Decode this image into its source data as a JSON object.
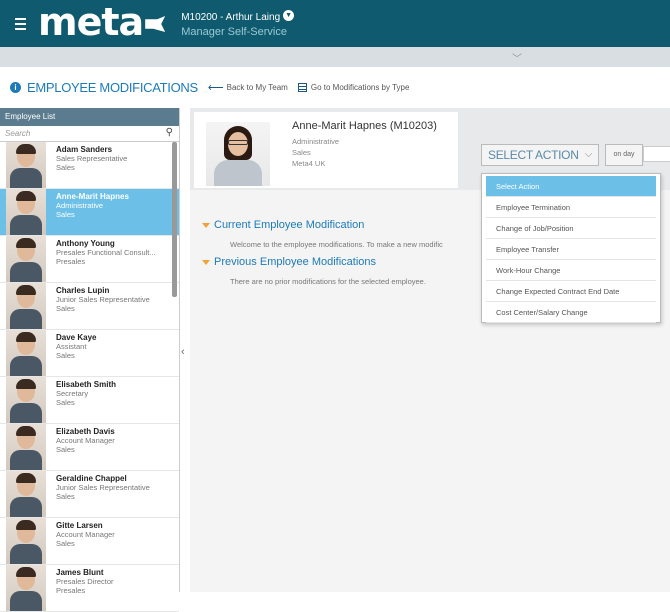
{
  "header": {
    "logo_text": "meta",
    "user_name": "M10200 - Arthur Laing",
    "user_role": "Manager Self-Service"
  },
  "toolbar": {
    "page_title": "EMPLOYEE MODIFICATIONS",
    "back_label": "Back to My Team",
    "by_type_label": "Go to Modifications by Type"
  },
  "sidebar": {
    "title": "Employee List",
    "search_placeholder": "Search",
    "employees": [
      {
        "name": "Adam Sanders",
        "title": "Sales Representative",
        "dept": "Sales"
      },
      {
        "name": "Anne-Marit Hapnes",
        "title": "Administrative",
        "dept": "Sales"
      },
      {
        "name": "Anthony Young",
        "title": "Presales Functional Consult...",
        "dept": "Presales"
      },
      {
        "name": "Charles Lupin",
        "title": "Junior Sales Representative",
        "dept": "Sales"
      },
      {
        "name": "Dave Kaye",
        "title": "Assistant",
        "dept": "Sales"
      },
      {
        "name": "Elisabeth Smith",
        "title": "Secretary",
        "dept": "Sales"
      },
      {
        "name": "Elizabeth Davis",
        "title": "Account Manager",
        "dept": "Sales"
      },
      {
        "name": "Geraldine Chappel",
        "title": "Junior Sales Representative",
        "dept": "Sales"
      },
      {
        "name": "Gitte Larsen",
        "title": "Account Manager",
        "dept": "Sales"
      },
      {
        "name": "James Blunt",
        "title": "Presales Director",
        "dept": "Presales"
      }
    ]
  },
  "employee_card": {
    "name": "Anne-Marit Hapnes (M10203)",
    "role": "Administrative",
    "dept": "Sales",
    "company": "Meta4 UK"
  },
  "action": {
    "select_label": "SELECT ACTION",
    "on_day_label": "on day",
    "options": [
      "Select Action",
      "Employee Termination",
      "Change of Job/Position",
      "Employee Transfer",
      "Work-Hour Change",
      "Change Expected Contract End Date",
      "Cost Center/Salary Change"
    ]
  },
  "sections": {
    "current_title": "Current Employee Modification",
    "current_text": "Welcome to the employee modifications. To make a new modific",
    "previous_title": "Previous Employee Modifications",
    "previous_text": "There are no prior modifications for the selected employee."
  },
  "colors": {
    "header_bg": "#0f5a6e",
    "accent_blue": "#1d7bb8",
    "selected_bg": "#6cc0e8",
    "triangle_orange": "#f2a23a"
  }
}
